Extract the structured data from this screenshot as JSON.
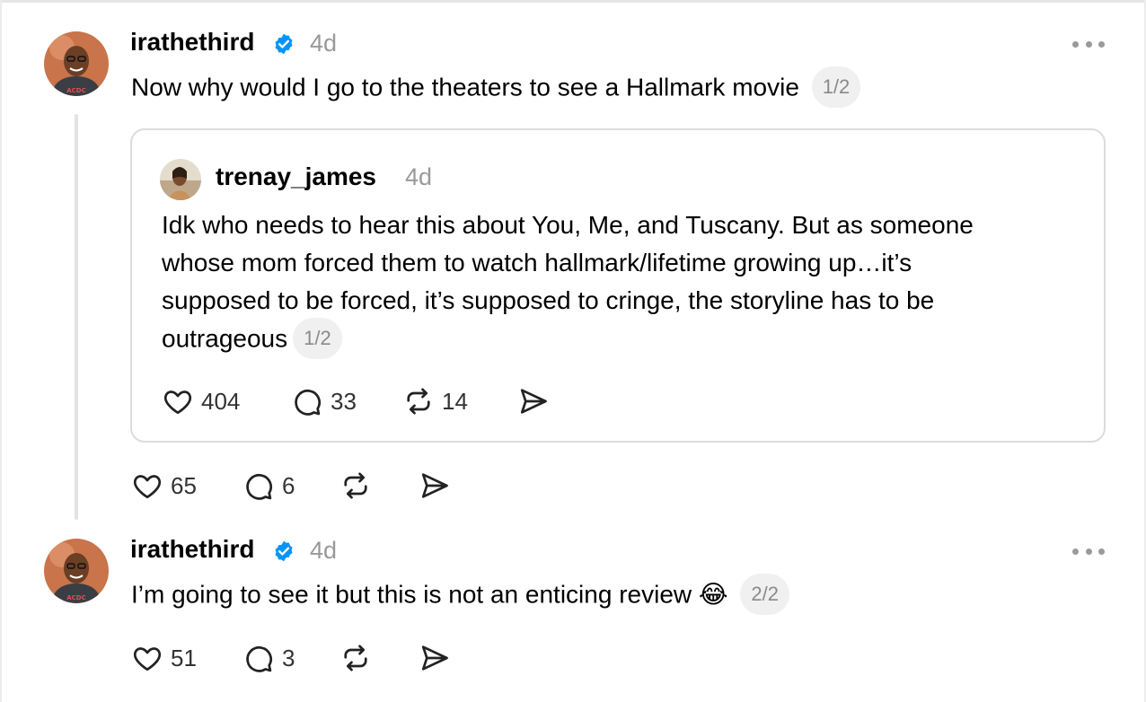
{
  "posts": [
    {
      "username": "irathethird",
      "verified": true,
      "time": "4d",
      "text": "Now why would I go to the theaters to see a Hallmark movie",
      "thread_index": "1/2",
      "actions": {
        "likes": "65",
        "replies": "6",
        "reposts": "",
        "shares": ""
      }
    },
    {
      "username": "irathethird",
      "verified": true,
      "time": "4d",
      "text": "I’m going to see it but this is not an enticing review 😂",
      "thread_index": "2/2",
      "actions": {
        "likes": "51",
        "replies": "3",
        "reposts": "",
        "shares": ""
      }
    }
  ],
  "quoted_post": {
    "username": "trenay_james",
    "time": "4d",
    "lines": [
      "Idk who needs to hear this about You, Me, and Tuscany. But as someone",
      "whose mom forced them to watch hallmark/lifetime growing up…it’s",
      "supposed to be forced, it’s supposed to cringe, the storyline has to be",
      "outrageous"
    ],
    "thread_index": "1/2",
    "actions": {
      "likes": "404",
      "replies": "33",
      "reposts": "14"
    }
  },
  "icons": {
    "verified": "verified-badge-icon",
    "more": "more-options-icon",
    "like": "heart-icon",
    "reply": "comment-icon",
    "repost": "repost-icon",
    "share": "send-icon"
  },
  "colors": {
    "verified": "#0095f6",
    "secondary_text": "#999999",
    "card_border": "#dcdcdc",
    "pill_bg": "#f0f0f0"
  }
}
